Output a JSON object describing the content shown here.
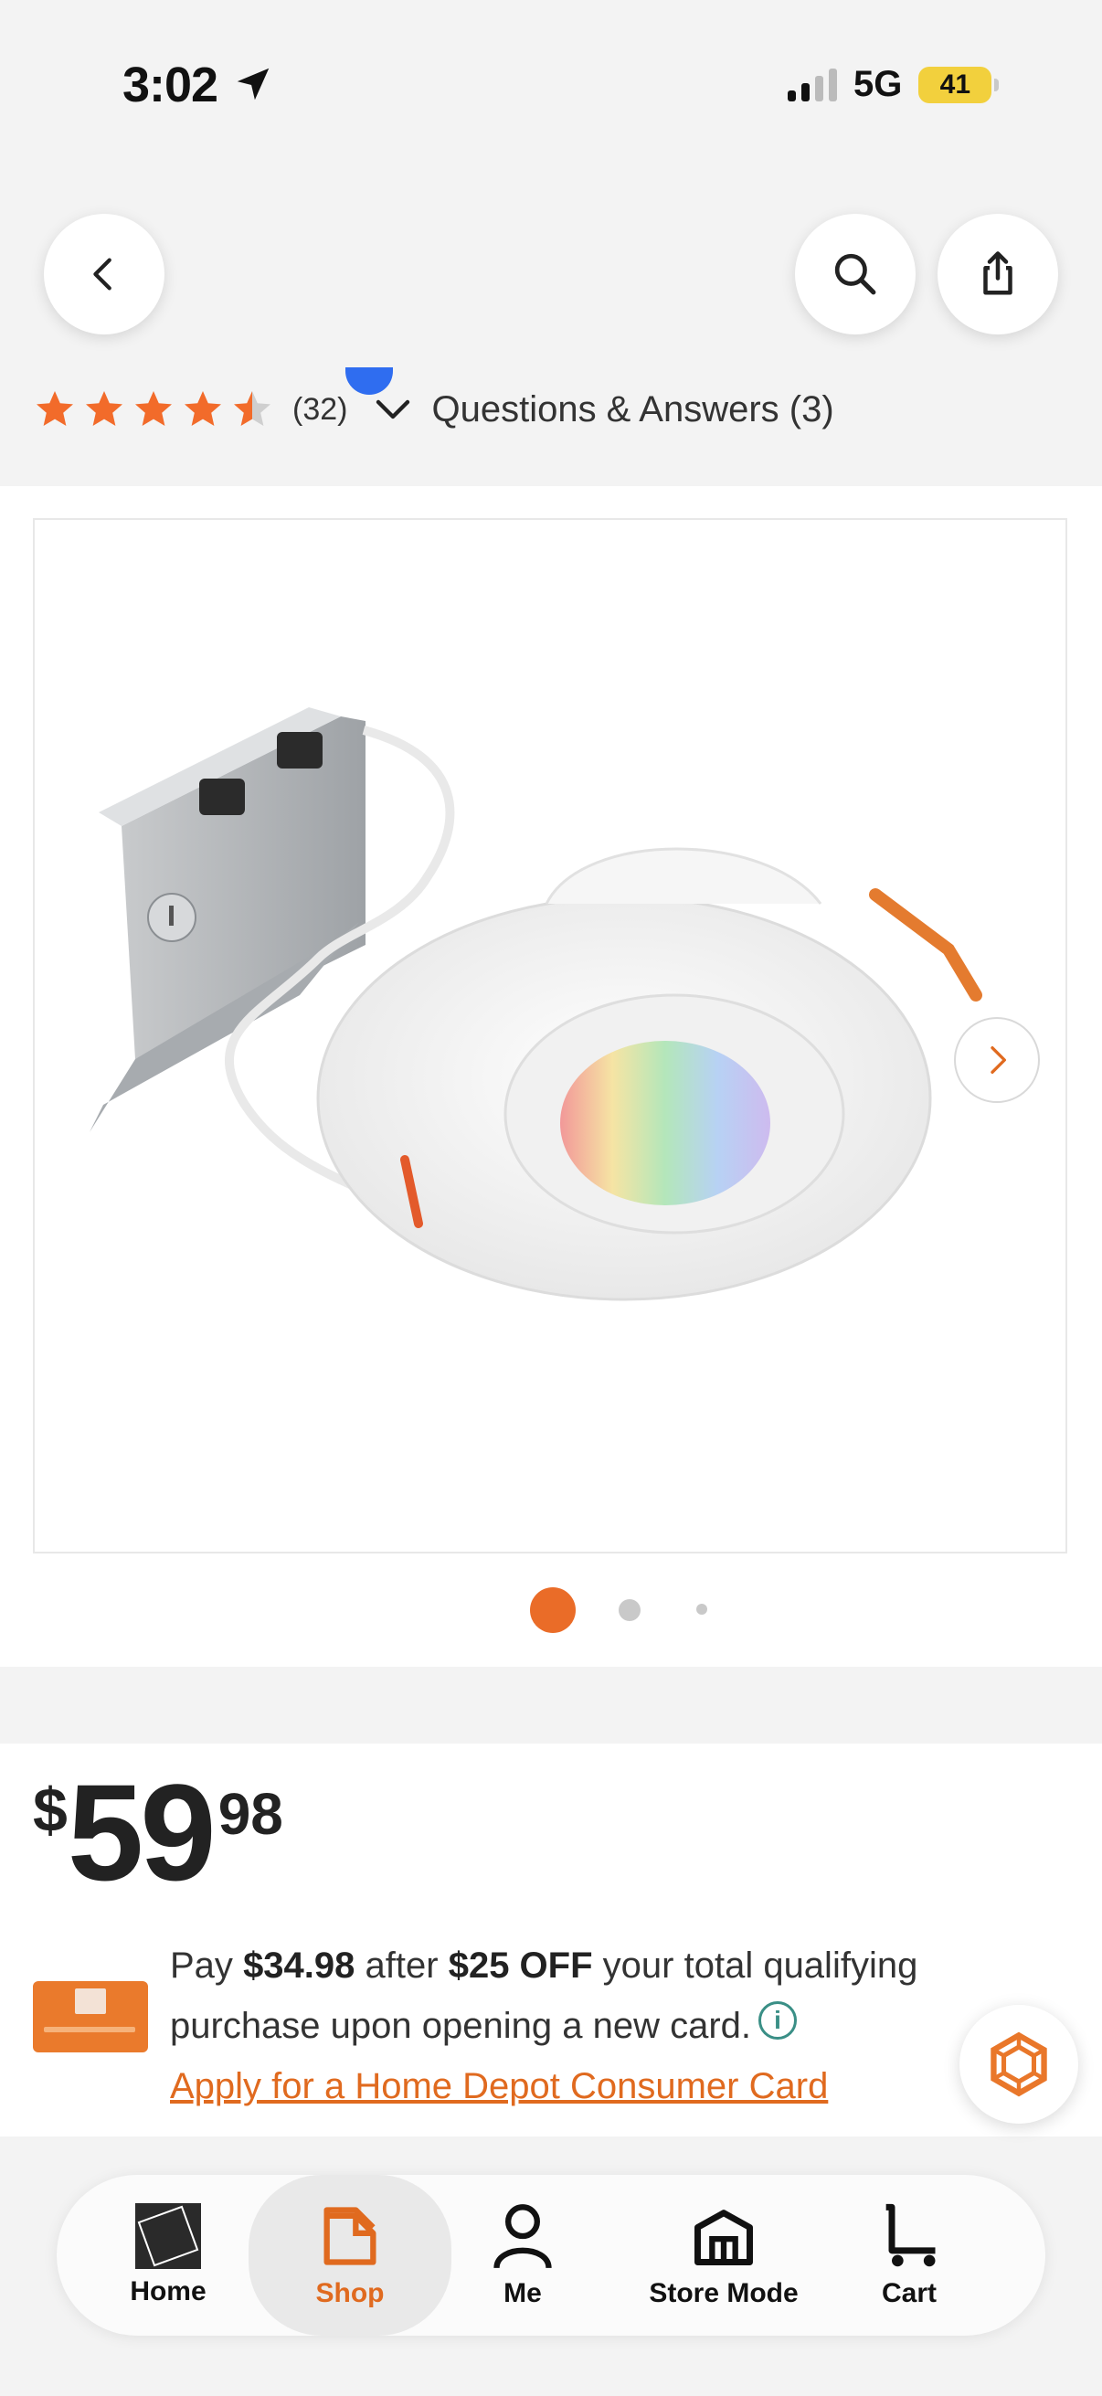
{
  "status_bar": {
    "time": "3:02",
    "network": "5G",
    "battery": "41"
  },
  "top_bar": {
    "back_icon": "chevron-left-icon",
    "search_icon": "search-icon",
    "share_icon": "share-icon"
  },
  "rating": {
    "stars": 4.5,
    "review_count": "(32)",
    "qa_label": "Questions & Answers (3)"
  },
  "gallery": {
    "image_count": 3,
    "active_index": 0
  },
  "price": {
    "currency": "$",
    "dollars": "59",
    "cents": "98"
  },
  "promo": {
    "pay_prefix": "Pay",
    "pay_amount": "$34.98",
    "after_text": "after",
    "discount": "$25 OFF",
    "rest_text": "your total qualifying purchase upon opening a new card.",
    "link_text": "Apply for a Home Depot Consumer Card"
  },
  "nav": {
    "items": [
      {
        "label": "Home",
        "icon": "home-depot-logo-icon"
      },
      {
        "label": "Shop",
        "icon": "shop-icon",
        "active": true
      },
      {
        "label": "Me",
        "icon": "person-icon"
      },
      {
        "label": "Store Mode",
        "icon": "store-icon"
      },
      {
        "label": "Cart",
        "icon": "cart-icon"
      }
    ]
  },
  "colors": {
    "accent": "#e06a1f",
    "star": "#f26b2a",
    "info": "#3a8f86"
  }
}
